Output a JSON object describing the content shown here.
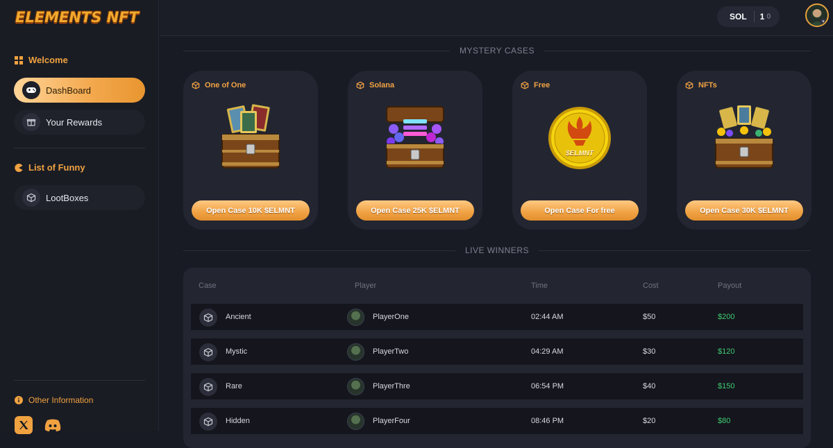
{
  "brand": {
    "logo_text": "ELEMENTS NFT"
  },
  "sidebar": {
    "sections": [
      {
        "title": "Welcome"
      },
      {
        "title": "List of Funny"
      }
    ],
    "items": [
      {
        "label": "DashBoard",
        "active": true
      },
      {
        "label": "Your Rewards",
        "active": false
      },
      {
        "label": "LootBoxes",
        "active": false
      }
    ],
    "footer": {
      "title": "Other Information"
    }
  },
  "header": {
    "currency": "SOL",
    "balance_main": "1",
    "balance_sub": "0"
  },
  "mystery_cases": {
    "heading": "MYSTERY CASES",
    "cards": [
      {
        "title": "One of One",
        "button": "Open Case 10K $ELMNT",
        "art": "treasure-chest-nft-cards"
      },
      {
        "title": "Solana",
        "button": "Open Case 25K $ELMNT",
        "art": "treasure-chest-solana-coins"
      },
      {
        "title": "Free",
        "button": "Open Case For free",
        "art": "elmnt-gold-coin",
        "coin_text": "$ELMNT"
      },
      {
        "title": "NFTs",
        "button": "Open Case 30K $ELMNT",
        "art": "treasure-chest-nfts"
      }
    ]
  },
  "live_winners": {
    "heading": "LIVE WINNERS",
    "columns": [
      "Case",
      "Player",
      "Time",
      "Cost",
      "Payout"
    ],
    "rows": [
      {
        "case": "Ancient",
        "player": "PlayerOne",
        "time": "02:44 AM",
        "cost": "$50",
        "payout": "$200"
      },
      {
        "case": "Mystic",
        "player": "PlayerTwo",
        "time": "04:29 AM",
        "cost": "$30",
        "payout": "$120"
      },
      {
        "case": "Rare",
        "player": "PlayerThre",
        "time": "06:54 PM",
        "cost": "$40",
        "payout": "$150"
      },
      {
        "case": "Hidden",
        "player": "PlayerFour",
        "time": "08:46 PM",
        "cost": "$20",
        "payout": "$80"
      }
    ]
  },
  "colors": {
    "accent": "#f0a240",
    "background": "#191b24",
    "card": "#232631",
    "payout": "#3fcb72"
  }
}
